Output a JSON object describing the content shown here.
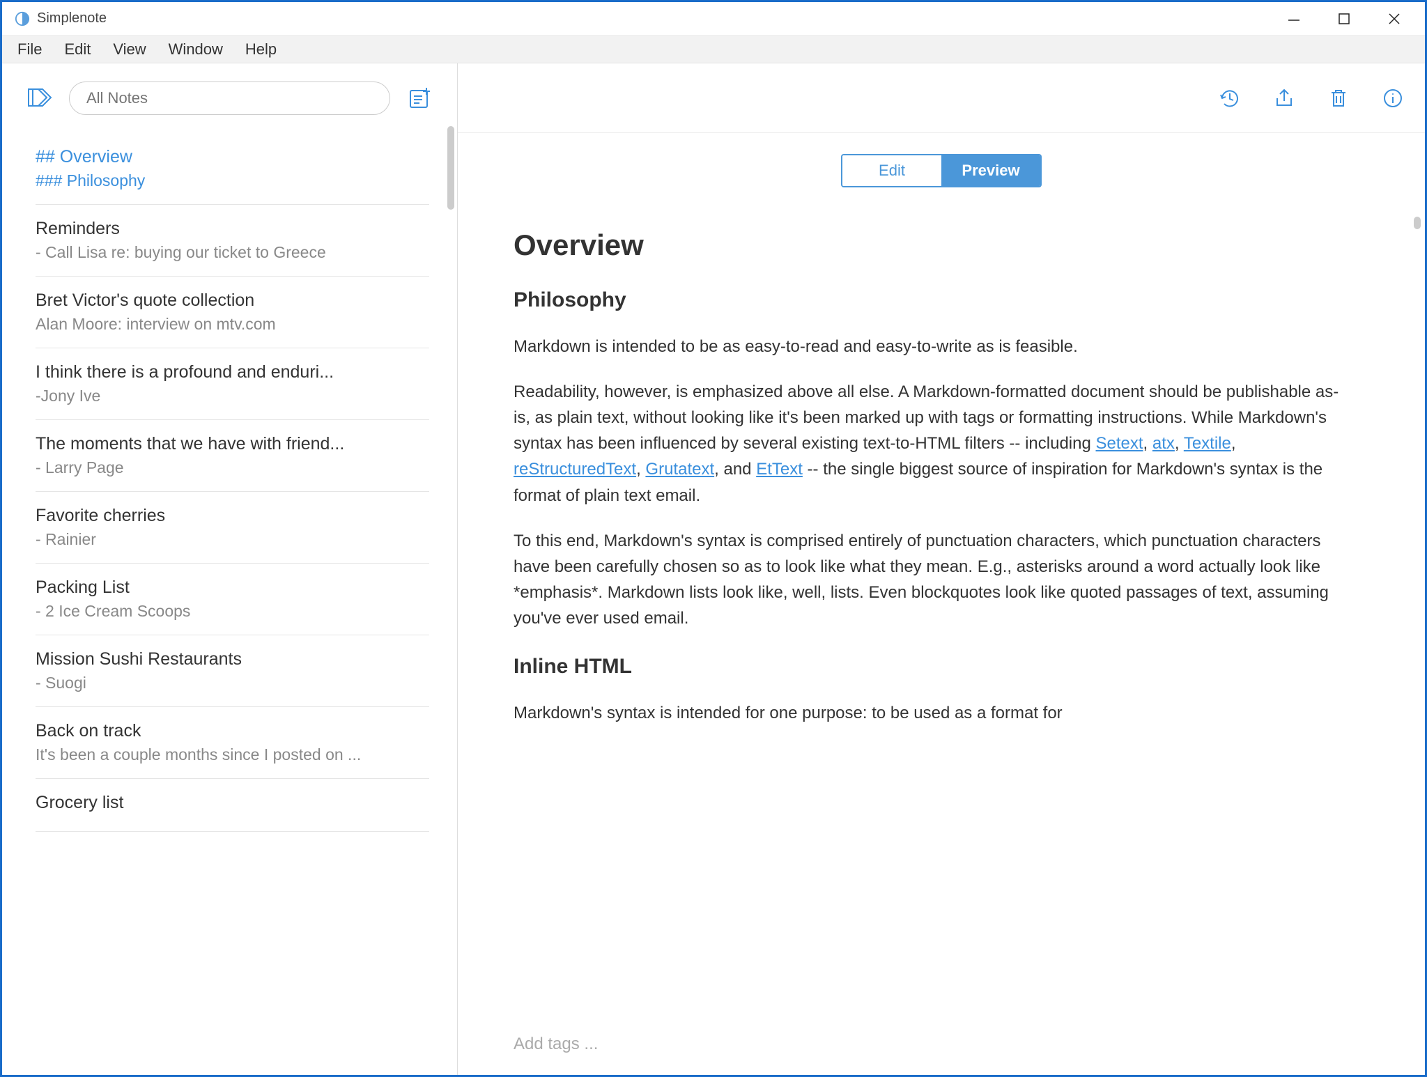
{
  "titlebar": {
    "app_name": "Simplenote"
  },
  "menubar": {
    "items": [
      "File",
      "Edit",
      "View",
      "Window",
      "Help"
    ]
  },
  "sidebar": {
    "search_placeholder": "All Notes",
    "notes": [
      {
        "title": "## Overview",
        "preview": "### Philosophy",
        "active": true
      },
      {
        "title": "Reminders",
        "preview": "- Call Lisa re: buying our ticket to Greece",
        "active": false
      },
      {
        "title": "Bret Victor's quote collection",
        "preview": "Alan Moore: interview on mtv.com",
        "active": false
      },
      {
        "title": "I think there is a profound and enduri...",
        "preview": "-Jony Ive",
        "active": false
      },
      {
        "title": "The moments that we have with friend...",
        "preview": "- Larry Page",
        "active": false
      },
      {
        "title": "Favorite cherries",
        "preview": "- Rainier",
        "active": false
      },
      {
        "title": "Packing List",
        "preview": "- 2 Ice Cream Scoops",
        "active": false
      },
      {
        "title": "Mission Sushi Restaurants",
        "preview": "- Suogi",
        "active": false
      },
      {
        "title": "Back on track",
        "preview": "It's been a couple months since I posted on ...",
        "active": false
      },
      {
        "title": "Grocery list",
        "preview": "",
        "active": false
      }
    ]
  },
  "mode_toggle": {
    "edit": "Edit",
    "preview": "Preview",
    "active": "preview"
  },
  "content": {
    "h2": "Overview",
    "h3a": "Philosophy",
    "p1": "Markdown is intended to be as easy-to-read and easy-to-write as is feasible.",
    "p2_pre": "Readability, however, is emphasized above all else. A Markdown-formatted document should be publishable as-is, as plain text, without looking like it's been marked up with tags or formatting instructions. While Markdown's syntax has been influenced by several existing text-to-HTML filters -- including ",
    "links": {
      "setext": "Setext",
      "atx": "atx",
      "textile": "Textile",
      "rst": "reStructuredText",
      "grutatext": "Grutatext",
      "ettext": "EtText"
    },
    "p2_post": " -- the single biggest source of inspiration for Markdown's syntax is the format of plain text email.",
    "p3": "To this end, Markdown's syntax is comprised entirely of punctuation characters, which punctuation characters have been carefully chosen so as to look like what they mean. E.g., asterisks around a word actually look like *emphasis*. Markdown lists look like, well, lists. Even blockquotes look like quoted passages of text, assuming you've ever used email.",
    "h3b": "Inline HTML",
    "p4": "Markdown's syntax is intended for one purpose: to be used as a format for"
  },
  "tags_placeholder": "Add tags ..."
}
